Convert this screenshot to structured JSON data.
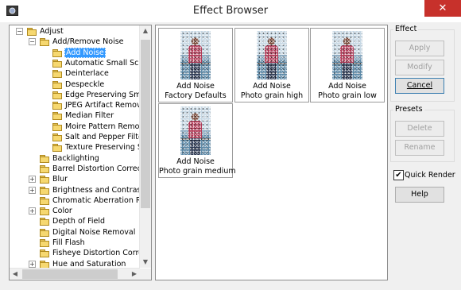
{
  "window": {
    "title": "Effect Browser",
    "close_glyph": "✕"
  },
  "tree": {
    "items": [
      {
        "label": "Adjust",
        "level": 1,
        "expander": "−",
        "folder": "closed"
      },
      {
        "label": "Add/Remove Noise",
        "level": 2,
        "expander": "−",
        "folder": "closed"
      },
      {
        "label": "Add Noise",
        "level": 3,
        "expander": "",
        "folder": "open",
        "selected": true
      },
      {
        "label": "Automatic Small Scratch Removal",
        "level": 3,
        "expander": "",
        "folder": "closed"
      },
      {
        "label": "Deinterlace",
        "level": 3,
        "expander": "",
        "folder": "closed"
      },
      {
        "label": "Despeckle",
        "level": 3,
        "expander": "",
        "folder": "closed"
      },
      {
        "label": "Edge Preserving Smooth",
        "level": 3,
        "expander": "",
        "folder": "closed"
      },
      {
        "label": "JPEG Artifact Removal",
        "level": 3,
        "expander": "",
        "folder": "closed"
      },
      {
        "label": "Median Filter",
        "level": 3,
        "expander": "",
        "folder": "closed"
      },
      {
        "label": "Moire Pattern Removal",
        "level": 3,
        "expander": "",
        "folder": "closed"
      },
      {
        "label": "Salt and Pepper Filter",
        "level": 3,
        "expander": "",
        "folder": "closed"
      },
      {
        "label": "Texture Preserving Smooth",
        "level": 3,
        "expander": "",
        "folder": "closed"
      },
      {
        "label": "Backlighting",
        "level": 2,
        "expander": "",
        "folder": "closed"
      },
      {
        "label": "Barrel Distortion Correction",
        "level": 2,
        "expander": "",
        "folder": "closed"
      },
      {
        "label": "Blur",
        "level": 2,
        "expander": "+",
        "folder": "closed"
      },
      {
        "label": "Brightness and Contrast",
        "level": 2,
        "expander": "+",
        "folder": "closed"
      },
      {
        "label": "Chromatic Aberration Removal",
        "level": 2,
        "expander": "",
        "folder": "closed"
      },
      {
        "label": "Color",
        "level": 2,
        "expander": "+",
        "folder": "closed"
      },
      {
        "label": "Depth of Field",
        "level": 2,
        "expander": "",
        "folder": "closed"
      },
      {
        "label": "Digital Noise Removal",
        "level": 2,
        "expander": "",
        "folder": "closed"
      },
      {
        "label": "Fill Flash",
        "level": 2,
        "expander": "",
        "folder": "closed"
      },
      {
        "label": "Fisheye Distortion Correction",
        "level": 2,
        "expander": "",
        "folder": "closed"
      },
      {
        "label": "Hue and Saturation",
        "level": 2,
        "expander": "+",
        "folder": "closed"
      }
    ],
    "scroll_up": "▲",
    "scroll_down": "▼",
    "scroll_left": "◀",
    "scroll_right": "▶"
  },
  "presets_grid": [
    {
      "effect": "Add Noise",
      "preset": "Factory Defaults"
    },
    {
      "effect": "Add Noise",
      "preset": "Photo grain high"
    },
    {
      "effect": "Add Noise",
      "preset": "Photo grain low"
    },
    {
      "effect": "Add Noise",
      "preset": "Photo grain medium"
    }
  ],
  "effect_group": {
    "title": "Effect",
    "apply": "Apply",
    "modify": "Modify",
    "cancel": "Cancel"
  },
  "presets_group": {
    "title": "Presets",
    "delete": "Delete",
    "rename": "Rename"
  },
  "quick_render": {
    "label": "Quick Render",
    "checked": true,
    "check_glyph": "✔"
  },
  "help_button": "Help",
  "colors": {
    "selection": "#3399ff",
    "close_button": "#c7312b",
    "folder": "#f6d870"
  }
}
